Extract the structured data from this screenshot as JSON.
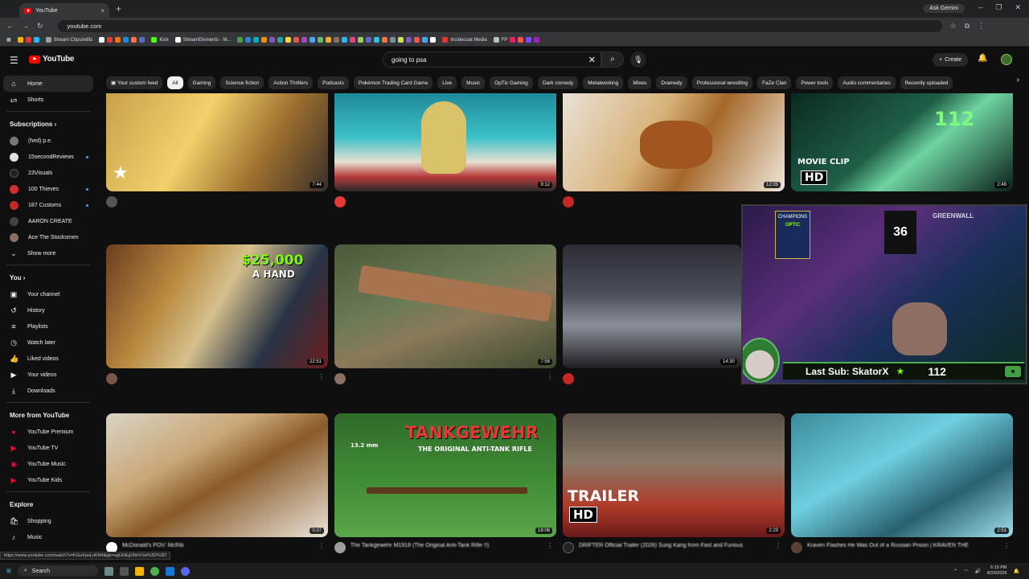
{
  "browser": {
    "tab_title": "YouTube",
    "tab_close": "×",
    "new_tab": "+",
    "ask_gemini": "Ask Gemini",
    "url": "youtube.com",
    "status_url": "https://www.youtube.com/watch?v=KGuXpuLoKN4&pp=ugUHEgVlbiVUw%3D%3D",
    "bookmarks": [
      "Stream Clips/edits",
      "Kick",
      "StreamElements - M...",
      "Incidecoat Media",
      "FP"
    ]
  },
  "header": {
    "brand": "YouTube",
    "search_value": "going to psa",
    "create_label": "Create"
  },
  "sidebar": {
    "top": [
      {
        "label": "Home",
        "icon": "home-icon"
      },
      {
        "label": "Shorts",
        "icon": "shorts-icon"
      }
    ],
    "subscriptions_heading": "Subscriptions",
    "subscriptions": [
      {
        "label": "(hed) p.e.",
        "color": "#777777",
        "dot": false
      },
      {
        "label": "15secondReviews",
        "color": "#e0e0e0",
        "dot": true
      },
      {
        "label": "23Visuals",
        "color": "#212121",
        "dot": false
      },
      {
        "label": "100 Thieves",
        "color": "#d32f2f",
        "dot": true
      },
      {
        "label": "187 Customs",
        "color": "#c62828",
        "dot": true
      },
      {
        "label": "AARON CREATE",
        "color": "#424242",
        "dot": false
      },
      {
        "label": "Ace The Stocksmen",
        "color": "#8d6e63",
        "dot": false
      }
    ],
    "show_more": "Show more",
    "you_heading": "You",
    "you_items": [
      {
        "label": "Your channel",
        "icon": "channel-icon"
      },
      {
        "label": "History",
        "icon": "history-icon"
      },
      {
        "label": "Playlists",
        "icon": "playlists-icon"
      },
      {
        "label": "Watch later",
        "icon": "watch-later-icon"
      },
      {
        "label": "Liked videos",
        "icon": "like-icon"
      },
      {
        "label": "Your videos",
        "icon": "your-videos-icon"
      },
      {
        "label": "Downloads",
        "icon": "download-icon"
      }
    ],
    "more_heading": "More from YouTube",
    "more_items": [
      "YouTube Premium",
      "YouTube TV",
      "YouTube Music",
      "YouTube Kids"
    ],
    "explore_heading": "Explore",
    "explore_items": [
      "Shopping",
      "Music"
    ]
  },
  "chips": [
    "Your custom feed",
    "All",
    "Gaming",
    "Science fiction",
    "Action Thrillers",
    "Podcasts",
    "Pokémon Trading Card Game",
    "Live",
    "Music",
    "OpTic Gaming",
    "Dark comedy",
    "Metalworking",
    "Mixes",
    "Dramedy",
    "Professional wrestling",
    "FaZe Clan",
    "Power tools",
    "Audio commentaries",
    "Recently uploaded"
  ],
  "videos": {
    "row1": [
      {
        "title": "",
        "dur": "7:44"
      },
      {
        "title": "",
        "dur": "9:12"
      },
      {
        "title": "",
        "dur": "12:05"
      },
      {
        "title": "",
        "dur": "2:48",
        "overlay_a": "112",
        "overlay_b": "MOVIE CLIP",
        "overlay_c": "HD"
      }
    ],
    "row2": [
      {
        "title": "",
        "dur": "22:51",
        "overlay_a": "$25,000",
        "overlay_b": "A HAND"
      },
      {
        "title": "",
        "dur": "7:58"
      },
      {
        "title": "",
        "dur": "14:30"
      }
    ],
    "row3": [
      {
        "title": "McDonald's POV: McRib",
        "dur": "0:37"
      },
      {
        "title": "The Tankgewehr M1918 (The Original Anti-Tank Rifle !!)",
        "dur": "18:06",
        "overlay_a": "TANKGEWEHR",
        "overlay_b": "THE ORIGINAL ANTI-TANK RIFLE",
        "overlay_c": "13.2 mm"
      },
      {
        "title": "DRIFTER Official Trailer (2026) Sung Kang from Fast and Furious",
        "dur": "2:29",
        "overlay_a": "TRAILER",
        "overlay_b": "HD"
      },
      {
        "title": "Kraven Flashes He Was Out of a Russian Prison | KRAVEN THE",
        "dur": "2:51"
      }
    ]
  },
  "overlay": {
    "last_sub": "Last Sub: SkatorX",
    "count": "112",
    "poster_a": "CHAMPIONS",
    "poster_b": "OPTIC",
    "jersey": "36",
    "banner": "GREENWALL"
  },
  "taskbar": {
    "search": "Search",
    "time": "6:19 PM",
    "date": "8/23/2026"
  }
}
